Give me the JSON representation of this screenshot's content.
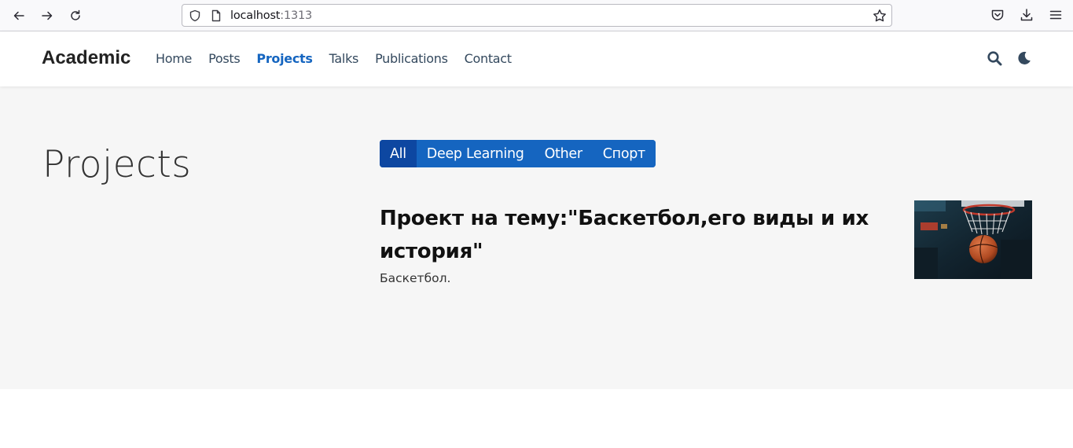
{
  "browser": {
    "url_host": "localhost",
    "url_port": ":1313"
  },
  "site": {
    "brand": "Academic",
    "menu": [
      {
        "label": "Home"
      },
      {
        "label": "Posts"
      },
      {
        "label": "Projects"
      },
      {
        "label": "Talks"
      },
      {
        "label": "Publications"
      },
      {
        "label": "Contact"
      }
    ],
    "active_menu": "Projects"
  },
  "page": {
    "title": "Projects",
    "filters": [
      {
        "label": "All"
      },
      {
        "label": "Deep Learning"
      },
      {
        "label": "Other"
      },
      {
        "label": "Спорт"
      }
    ],
    "active_filter": "All",
    "project": {
      "title": "Проект на тему:\"Баскетбол,его виды и их история\"",
      "summary": "Баскетбол."
    }
  },
  "colors": {
    "accent": "#1565c0",
    "accent_active": "#0d47a1",
    "page_background": "#f6f6f6"
  }
}
